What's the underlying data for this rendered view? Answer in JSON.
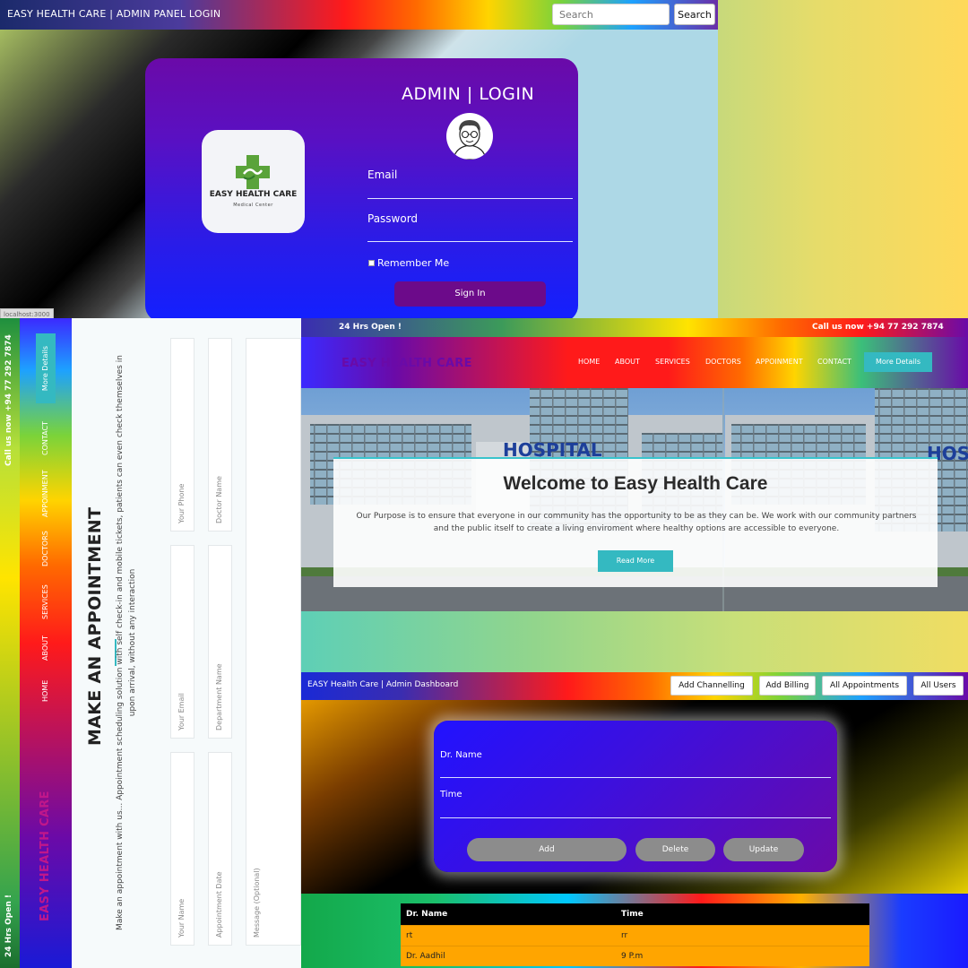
{
  "login_panel": {
    "brand": "EASY HEALTH CARE | ADMIN PANEL LOGIN",
    "search_placeholder": "Search",
    "search_button": "Search",
    "title": "ADMIN | LOGIN",
    "logo_name": "EASY HEALTH CARE",
    "logo_subtitle": "Medical Center",
    "email_label": "Email",
    "password_label": "Password",
    "remember_label": "Remember Me",
    "signin_button": "Sign In",
    "url_tip": "localhost:3000"
  },
  "appointment_panel": {
    "topbar_left": "24 Hrs Open !",
    "topbar_right": "Call us now +94 77 292 7874",
    "logo": "EASY HEALTH CARE",
    "nav": [
      "HOME",
      "ABOUT",
      "SERVICES",
      "DOCTORS",
      "APPOINMENT",
      "CONTACT"
    ],
    "more_details": "More Details",
    "title": "MAKE AN APPOINTMENT",
    "description": "Make an appointment with us... Appointment scheduling solution with self check-in and mobile tickets, patients can even check themselves in upon arrival, without any interaction",
    "fields": {
      "name": "Your Name",
      "email": "Your Email",
      "phone": "Your Phone",
      "date": "Appointment Date",
      "department": "Department Name",
      "doctor": "Doctor Name",
      "message": "Message (Optional)"
    }
  },
  "landing_panel": {
    "topbar_left": "24 Hrs Open !",
    "topbar_right": "Call us now +94 77 292 7874",
    "logo": "EASY HEALTH CARE",
    "nav": [
      "HOME",
      "ABOUT",
      "SERVICES",
      "DOCTORS",
      "APPOINMENT",
      "CONTACT"
    ],
    "more_details": "More Details",
    "hospital_sign": "HOSPITAL",
    "hero_title": "Welcome to Easy Health Care",
    "hero_text": "Our Purpose is to ensure that everyone in our community has the opportunity to be as they can be. We work with our community partners and the public itself to create a living enviroment where healthy options are accessible to everyone.",
    "read_more": "Read More"
  },
  "dashboard_panel": {
    "brand": "EASY Health Care | Admin Dashboard",
    "buttons": [
      "Add Channelling",
      "Add Billing",
      "All Appointments",
      "All Users"
    ],
    "form": {
      "doctor_label": "Dr. Name",
      "time_label": "Time",
      "add": "Add",
      "delete": "Delete",
      "update": "Update"
    },
    "table": {
      "headers": [
        "Dr. Name",
        "Time"
      ],
      "rows": [
        [
          "rt",
          "rr"
        ],
        [
          "Dr. Aadhil",
          "9 P.m"
        ]
      ]
    }
  },
  "colors": {
    "accent_teal": "#34b9c1",
    "login_card": "#5a10c2",
    "signin_purple": "#6c0a8a",
    "table_row": "#ffa500"
  }
}
